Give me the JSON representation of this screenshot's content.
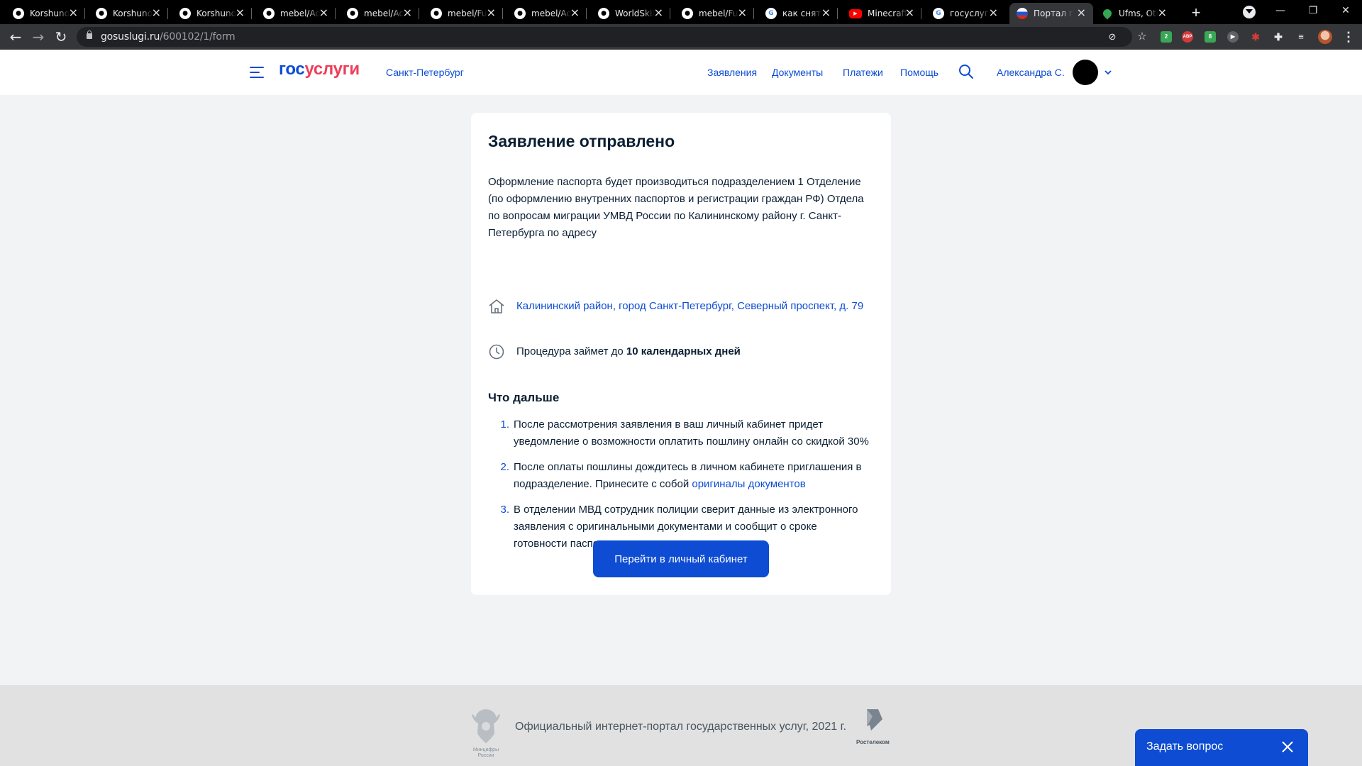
{
  "browser": {
    "tabs": [
      {
        "title": "Korshunov",
        "favicon": "github-icon"
      },
      {
        "title": "Korshunov",
        "favicon": "github-icon"
      },
      {
        "title": "Korshunov",
        "favicon": "github-icon"
      },
      {
        "title": "mebel/Ad",
        "favicon": "github-icon"
      },
      {
        "title": "mebel/Ad",
        "favicon": "github-icon"
      },
      {
        "title": "mebel/Fu",
        "favicon": "github-icon"
      },
      {
        "title": "mebel/Ad",
        "favicon": "github-icon"
      },
      {
        "title": "WorldSkill",
        "favicon": "github-icon"
      },
      {
        "title": "mebel/Fu",
        "favicon": "github-icon"
      },
      {
        "title": "как снять",
        "favicon": "google-icon"
      },
      {
        "title": "Minecraft",
        "favicon": "youtube-icon"
      },
      {
        "title": "госуслуги",
        "favicon": "google-icon"
      },
      {
        "title": "Портал го",
        "favicon": "gosuslugi-icon",
        "active": true
      },
      {
        "title": "Ufms, Otd",
        "favicon": "maps-icon"
      }
    ],
    "url_host": "gosuslugi.ru",
    "url_path": "/600102/1/form",
    "extensions": {
      "ext1_badge": "2",
      "ext2_label": "ABP",
      "ext3_badge": "8"
    }
  },
  "header": {
    "logo_part1": "гос",
    "logo_part2": "услуги",
    "region": "Санкт-Петербург",
    "nav": [
      "Заявления",
      "Документы",
      "Платежи",
      "Помощь"
    ],
    "user_name": "Александра С."
  },
  "card": {
    "title": "Заявление отправлено",
    "intro": "Оформление паспорта будет производиться подразделением 1 Отделение (по оформлению внутренних паспортов и регистрации граждан РФ) Отдела по вопросам миграции УМВД России по Калининскому району г. Санкт-Петербурга по адресу",
    "address": "Калининский район, город Санкт-Петербург, Северный проспект, д. 79",
    "duration_prefix": "Процедура займет до ",
    "duration_bold": "10 календарных дней",
    "next_title": "Что дальше",
    "steps": [
      {
        "num": "1.",
        "text": "После рассмотрения заявления в ваш личный кабинет придет уведомление о возможности оплатить пошлину онлайн со скидкой 30%"
      },
      {
        "num": "2.",
        "text": "После оплаты пошлины дождитесь в личном кабинете приглашения в подразделение. Принесите с собой ",
        "link": "оригиналы документов"
      },
      {
        "num": "3.",
        "text": "В отделении МВД сотрудник полиции сверит данные из электронного заявления с оригинальными документами и сообщит о сроке готовности паспорта"
      }
    ],
    "button": "Перейти в личный кабинет"
  },
  "footer": {
    "emblem_caption": "Минцифры России",
    "text": "Официальный интернет-портал государственных услуг, 2021 г.",
    "partner": "Ростелеком"
  },
  "help_widget": {
    "label": "Задать вопрос"
  },
  "colors": {
    "brand_blue": "#0d4cd3",
    "brand_red": "#ee3f58",
    "text": "#0b1f33"
  }
}
